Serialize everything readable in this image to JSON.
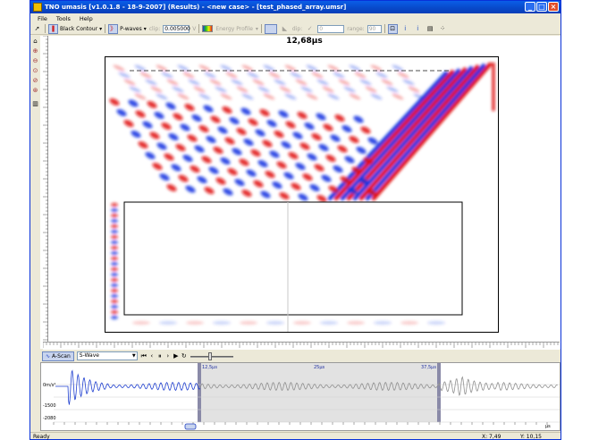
{
  "window": {
    "title": "TNO umasis [v1.0.1.8 - 18-9-2007] (Results) - <new case> - [test_phased_array.umsr]"
  },
  "menu": {
    "items": [
      "File",
      "Tools",
      "Help"
    ]
  },
  "toolbar": {
    "contour_mode": "Black Contour",
    "wave_mode": "P-waves",
    "clip_label": "clip:",
    "clip_value": "0.005000",
    "clip_unit": "V",
    "energy_label": "Energy Profile",
    "dip_label": "dip:",
    "dip_value": "0",
    "range_label": "range:",
    "range_value": "90"
  },
  "main": {
    "time_display": "12,68µs"
  },
  "ascan": {
    "button_label": "A-Scan",
    "wave_select": "S-Wave",
    "y_labels": [
      "0m/s²",
      "-1500",
      "-2080"
    ],
    "gate_labels": [
      "12,5µs",
      "25µs",
      "37,5µs"
    ],
    "time_unit": "µs",
    "slider_fraction": 0.45
  },
  "colors": {
    "positive": "#e01010",
    "negative": "#1030e0",
    "titlebar": "#0a5ee8",
    "gate": "#6868c0"
  },
  "status": {
    "text": "Ready",
    "x": "X: 7,49",
    "y": "Y: 10,15"
  }
}
